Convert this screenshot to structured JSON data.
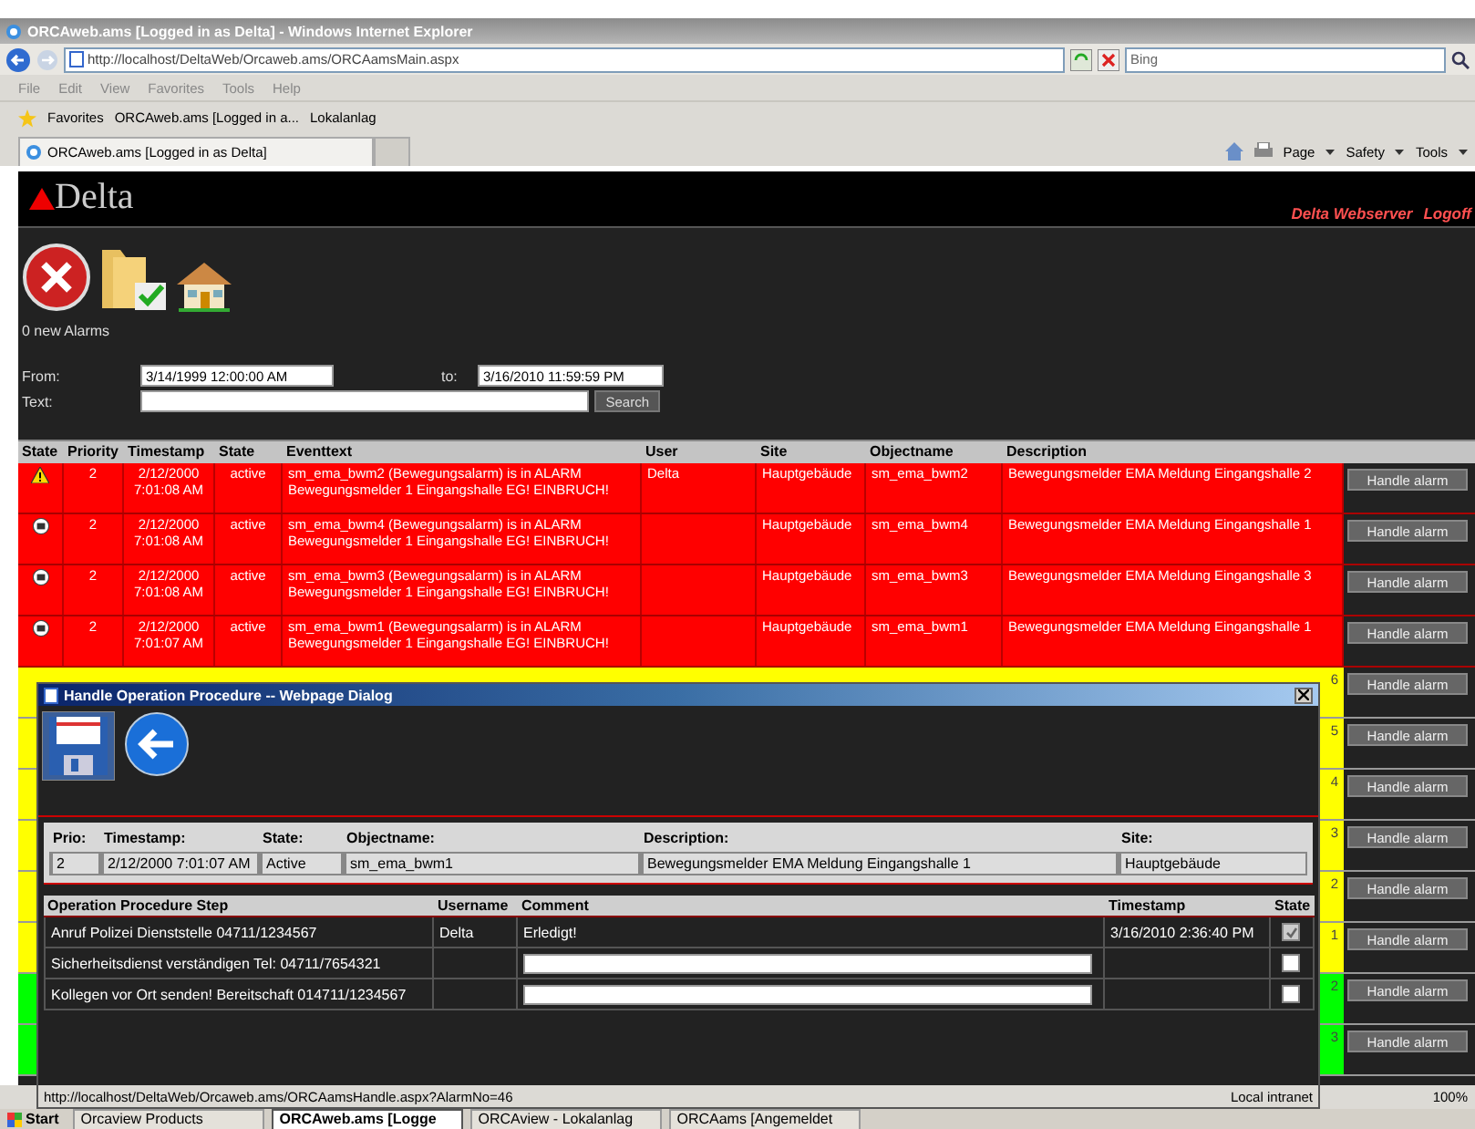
{
  "browser": {
    "title": "ORCAweb.ams [Logged in as Delta] - Windows Internet Explorer",
    "address": "http://localhost/DeltaWeb/Orcaweb.ams/ORCAamsMain.aspx",
    "search_placeholder": "Bing",
    "menu": [
      "File",
      "Edit",
      "View",
      "Favorites",
      "Tools",
      "Help"
    ],
    "favorites": [
      "Favorites",
      "ORCAweb.ams [Logged in a...",
      "Lokalanlag"
    ],
    "tab": "ORCAweb.ams [Logged in as Delta]",
    "commands": [
      "Page",
      "Safety",
      "Tools"
    ]
  },
  "header": {
    "brand": "Delta",
    "links": [
      "Delta Webserver",
      "Logoff"
    ]
  },
  "alarm_count": "0 new Alarms",
  "filter": {
    "from_label": "From:",
    "from": "3/14/1999 12:00:00 AM",
    "to_label": "to:",
    "to": "3/16/2010 11:59:59 PM",
    "text_label": "Text:",
    "search": "Search"
  },
  "alarms": {
    "columns": [
      "State",
      "Priority",
      "Timestamp",
      "State",
      "Eventtext",
      "User",
      "Site",
      "Objectname",
      "Description"
    ],
    "rows": [
      {
        "kind": "warning",
        "color": "#ff0000",
        "priority": "2",
        "timestamp": "2/12/2000 7:01:08 AM",
        "state": "active",
        "eventtext": "sm_ema_bwm2 (Bewegungsalarm) is in ALARM\nBewegungsmelder 1 Eingangshalle EG! EINBRUCH!",
        "user": "Delta",
        "site": "Hauptgebäude",
        "objectname": "sm_ema_bwm2",
        "description": "Bewegungsmelder EMA Meldung Eingangshalle 2",
        "action": "Handle alarm"
      },
      {
        "kind": "alarm",
        "color": "#ff0000",
        "priority": "2",
        "timestamp": "2/12/2000 7:01:08 AM",
        "state": "active",
        "eventtext": "sm_ema_bwm4 (Bewegungsalarm) is in ALARM\nBewegungsmelder 1 Eingangshalle EG! EINBRUCH!",
        "user": "",
        "site": "Hauptgebäude",
        "objectname": "sm_ema_bwm4",
        "description": "Bewegungsmelder EMA Meldung Eingangshalle 1",
        "action": "Handle alarm"
      },
      {
        "kind": "alarm",
        "color": "#ff0000",
        "priority": "2",
        "timestamp": "2/12/2000 7:01:08 AM",
        "state": "active",
        "eventtext": "sm_ema_bwm3 (Bewegungsalarm) is in ALARM\nBewegungsmelder 1 Eingangshalle EG! EINBRUCH!",
        "user": "",
        "site": "Hauptgebäude",
        "objectname": "sm_ema_bwm3",
        "description": "Bewegungsmelder EMA Meldung Eingangshalle 3",
        "action": "Handle alarm"
      },
      {
        "kind": "alarm",
        "color": "#ff0000",
        "priority": "2",
        "timestamp": "2/12/2000 7:01:07 AM",
        "state": "active",
        "eventtext": "sm_ema_bwm1 (Bewegungsalarm) is in ALARM\nBewegungsmelder 1 Eingangshalle EG! EINBRUCH!",
        "user": "",
        "site": "Hauptgebäude",
        "objectname": "sm_ema_bwm1",
        "description": "Bewegungsmelder EMA Meldung Eingangshalle 1",
        "action": "Handle alarm"
      }
    ],
    "covered_rows": [
      {
        "color": "#ffff00",
        "column_9": "6",
        "action": "Handle alarm"
      },
      {
        "color": "#ffff00",
        "column_9": "5",
        "action": "Handle alarm"
      },
      {
        "color": "#ffff00",
        "column_9": "4",
        "action": "Handle alarm"
      },
      {
        "color": "#ffff00",
        "column_9": "3",
        "action": "Handle alarm"
      },
      {
        "color": "#ffff00",
        "column_9": "2",
        "action": "Handle alarm"
      },
      {
        "color": "#ffff00",
        "column_9": "1",
        "action": "Handle alarm"
      },
      {
        "color": "#00ff00",
        "column_9": "2",
        "action": "Handle alarm"
      },
      {
        "color": "#00ff00",
        "column_9": "3",
        "action": "Handle alarm"
      }
    ]
  },
  "status_bar": {
    "zoom": "100%"
  },
  "dialog": {
    "title": "Handle Operation Procedure -- Webpage Dialog",
    "info": {
      "columns": [
        "Prio:",
        "Timestamp:",
        "State:",
        "Objectname:",
        "Description:",
        "Site:"
      ],
      "values": [
        "2",
        "2/12/2000 7:01:07 AM",
        "Active",
        "sm_ema_bwm1",
        "Bewegungsmelder EMA Meldung Eingangshalle 1",
        "Hauptgebäude"
      ]
    },
    "steps": {
      "columns": [
        "Operation Procedure Step",
        "Username",
        "Comment",
        "Timestamp",
        "State"
      ],
      "rows": [
        {
          "kind": "done",
          "step": "Anruf Polizei Dienststelle 04711/1234567",
          "user": "Delta",
          "comment": "Erledigt!",
          "timestamp": "3/16/2010 2:36:40 PM",
          "checked": true,
          "disabled": true
        },
        {
          "kind": "open",
          "step": "Sicherheitsdienst verständigen Tel: 04711/7654321",
          "user": "",
          "comment": "",
          "timestamp": "",
          "checked": false,
          "disabled": false
        },
        {
          "kind": "open",
          "step": "Kollegen vor Ort senden! Bereitschaft 014711/1234567",
          "user": "",
          "comment": "",
          "timestamp": "",
          "checked": false,
          "disabled": false
        }
      ]
    },
    "status_url": "http://localhost/DeltaWeb/Orcaweb.ams/ORCAamsHandle.aspx?AlarmNo=46",
    "zone": "Local intranet"
  },
  "taskbar": {
    "start": "Start",
    "items": [
      {
        "label": "Orcaview Products",
        "selected": false
      },
      {
        "label": "ORCAweb.ams [Logge",
        "selected": true
      },
      {
        "label": "ORCAview - Lokalanlag",
        "selected": false
      },
      {
        "label": "ORCAams [Angemeldet",
        "selected": false
      }
    ]
  }
}
